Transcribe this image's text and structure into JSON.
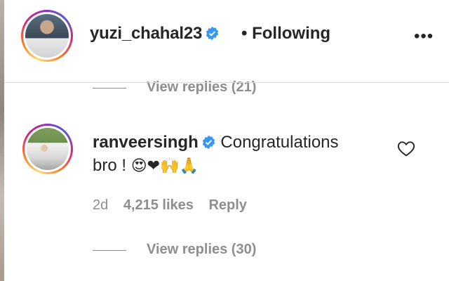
{
  "post_header": {
    "username": "yuzi_chahal23",
    "separator": "•",
    "follow_status": "Following",
    "more_label": "•••"
  },
  "top_replies": {
    "label": "View replies (21)"
  },
  "comment": {
    "username": "ranveersingh",
    "text_line1": "Congratulations",
    "text_line2": "bro !",
    "emojis": "😍❤🙌🙏",
    "time": "2d",
    "likes": "4,215 likes",
    "reply_label": "Reply"
  },
  "bottom_replies": {
    "label": "View replies (30)"
  },
  "colors": {
    "verified": "#3897f0",
    "muted": "#8e8e8e",
    "text": "#262626"
  },
  "icons": {
    "verified": "verified-badge-icon",
    "like": "heart-outline-icon",
    "more": "more-options-icon"
  }
}
